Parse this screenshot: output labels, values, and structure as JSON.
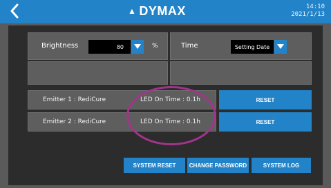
{
  "header": {
    "back_icon": "chevron-left-icon",
    "logo": "DYMAX",
    "time": "14:10",
    "date": "2021/1/13"
  },
  "settings": {
    "brightness_label": "Brightness",
    "brightness_value": "80",
    "brightness_unit": "%",
    "time_label": "Time",
    "time_value": "Setting Date"
  },
  "emitters": [
    {
      "name": "Emitter 1 : RediCure",
      "led_time": "LED On Time : 0.1h",
      "reset_label": "RESET"
    },
    {
      "name": "Emitter 2 : RediCure",
      "led_time": "LED On Time : 0.1h",
      "reset_label": "RESET"
    }
  ],
  "footer": {
    "system_reset": "SYSTEM RESET",
    "change_password": "CHANGE PASSWORD",
    "system_log": "SYSTEM LOG"
  },
  "colors": {
    "accent": "#2283c9",
    "highlight": "#a3348c"
  }
}
